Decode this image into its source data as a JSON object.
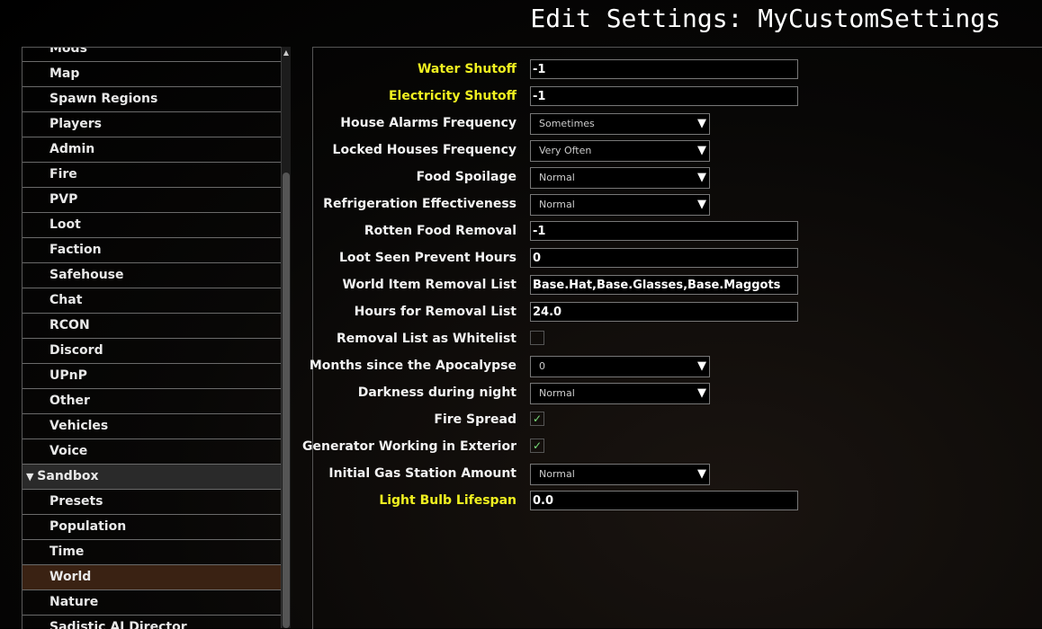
{
  "header": {
    "title": "Edit Settings: MyCustomSettings"
  },
  "sidebar": {
    "items": [
      {
        "label": "Mods"
      },
      {
        "label": "Map"
      },
      {
        "label": "Spawn Regions"
      },
      {
        "label": "Players"
      },
      {
        "label": "Admin"
      },
      {
        "label": "Fire"
      },
      {
        "label": "PVP"
      },
      {
        "label": "Loot"
      },
      {
        "label": "Faction"
      },
      {
        "label": "Safehouse"
      },
      {
        "label": "Chat"
      },
      {
        "label": "RCON"
      },
      {
        "label": "Discord"
      },
      {
        "label": "UPnP"
      },
      {
        "label": "Other"
      },
      {
        "label": "Vehicles"
      },
      {
        "label": "Voice"
      },
      {
        "label": "Sandbox",
        "header": true,
        "expanded": true
      },
      {
        "label": "Presets"
      },
      {
        "label": "Population"
      },
      {
        "label": "Time"
      },
      {
        "label": "World",
        "selected": true
      },
      {
        "label": "Nature"
      },
      {
        "label": "Sadistic AI Director"
      }
    ],
    "expand_icon": "triangle-down"
  },
  "colors": {
    "highlight_label": "#f0f020",
    "selected_bg": "#3a2213",
    "check": "#7be07b"
  },
  "settings": [
    {
      "label": "Water Shutoff",
      "type": "text",
      "value": "-1",
      "highlight": true
    },
    {
      "label": "Electricity Shutoff",
      "type": "text",
      "value": "-1",
      "highlight": true
    },
    {
      "label": "House Alarms Frequency",
      "type": "select",
      "value": "Sometimes"
    },
    {
      "label": "Locked Houses Frequency",
      "type": "select",
      "value": "Very Often"
    },
    {
      "label": "Food Spoilage",
      "type": "select",
      "value": "Normal"
    },
    {
      "label": "Refrigeration Effectiveness",
      "type": "select",
      "value": "Normal"
    },
    {
      "label": "Rotten Food Removal",
      "type": "text",
      "value": "-1"
    },
    {
      "label": "Loot Seen Prevent Hours",
      "type": "text",
      "value": "0"
    },
    {
      "label": "World Item Removal List",
      "type": "text",
      "value": "Base.Hat,Base.Glasses,Base.Maggots"
    },
    {
      "label": "Hours for Removal List",
      "type": "text",
      "value": "24.0"
    },
    {
      "label": "Removal List as Whitelist",
      "type": "checkbox",
      "checked": false
    },
    {
      "label": "Months since the Apocalypse",
      "type": "select",
      "value": "0"
    },
    {
      "label": "Darkness during night",
      "type": "select",
      "value": "Normal"
    },
    {
      "label": "Fire Spread",
      "type": "checkbox",
      "checked": true
    },
    {
      "label": "Generator Working in Exterior",
      "type": "checkbox",
      "checked": true
    },
    {
      "label": "Initial Gas Station Amount",
      "type": "select",
      "value": "Normal"
    },
    {
      "label": "Light Bulb Lifespan",
      "type": "text",
      "value": "0.0",
      "highlight": true
    }
  ]
}
